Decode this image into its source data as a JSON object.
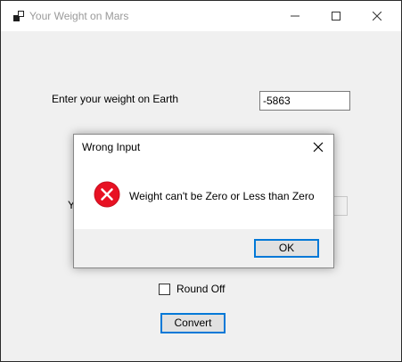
{
  "window": {
    "title": "Your Weight on Mars"
  },
  "form": {
    "earth_label": "Enter your weight on Earth",
    "weight_value": "-5863",
    "mars_label_partial": "Y",
    "mars_value": "",
    "roundoff_label": "Round Off",
    "roundoff_checked": false,
    "convert_label": "Convert"
  },
  "dialog": {
    "title": "Wrong Input",
    "message": "Weight can't be Zero or Less than Zero",
    "ok_label": "OK",
    "icon": "error-icon"
  },
  "colors": {
    "accent": "#0078d7",
    "error": "#e81123",
    "client_background": "#f0f0f0"
  }
}
